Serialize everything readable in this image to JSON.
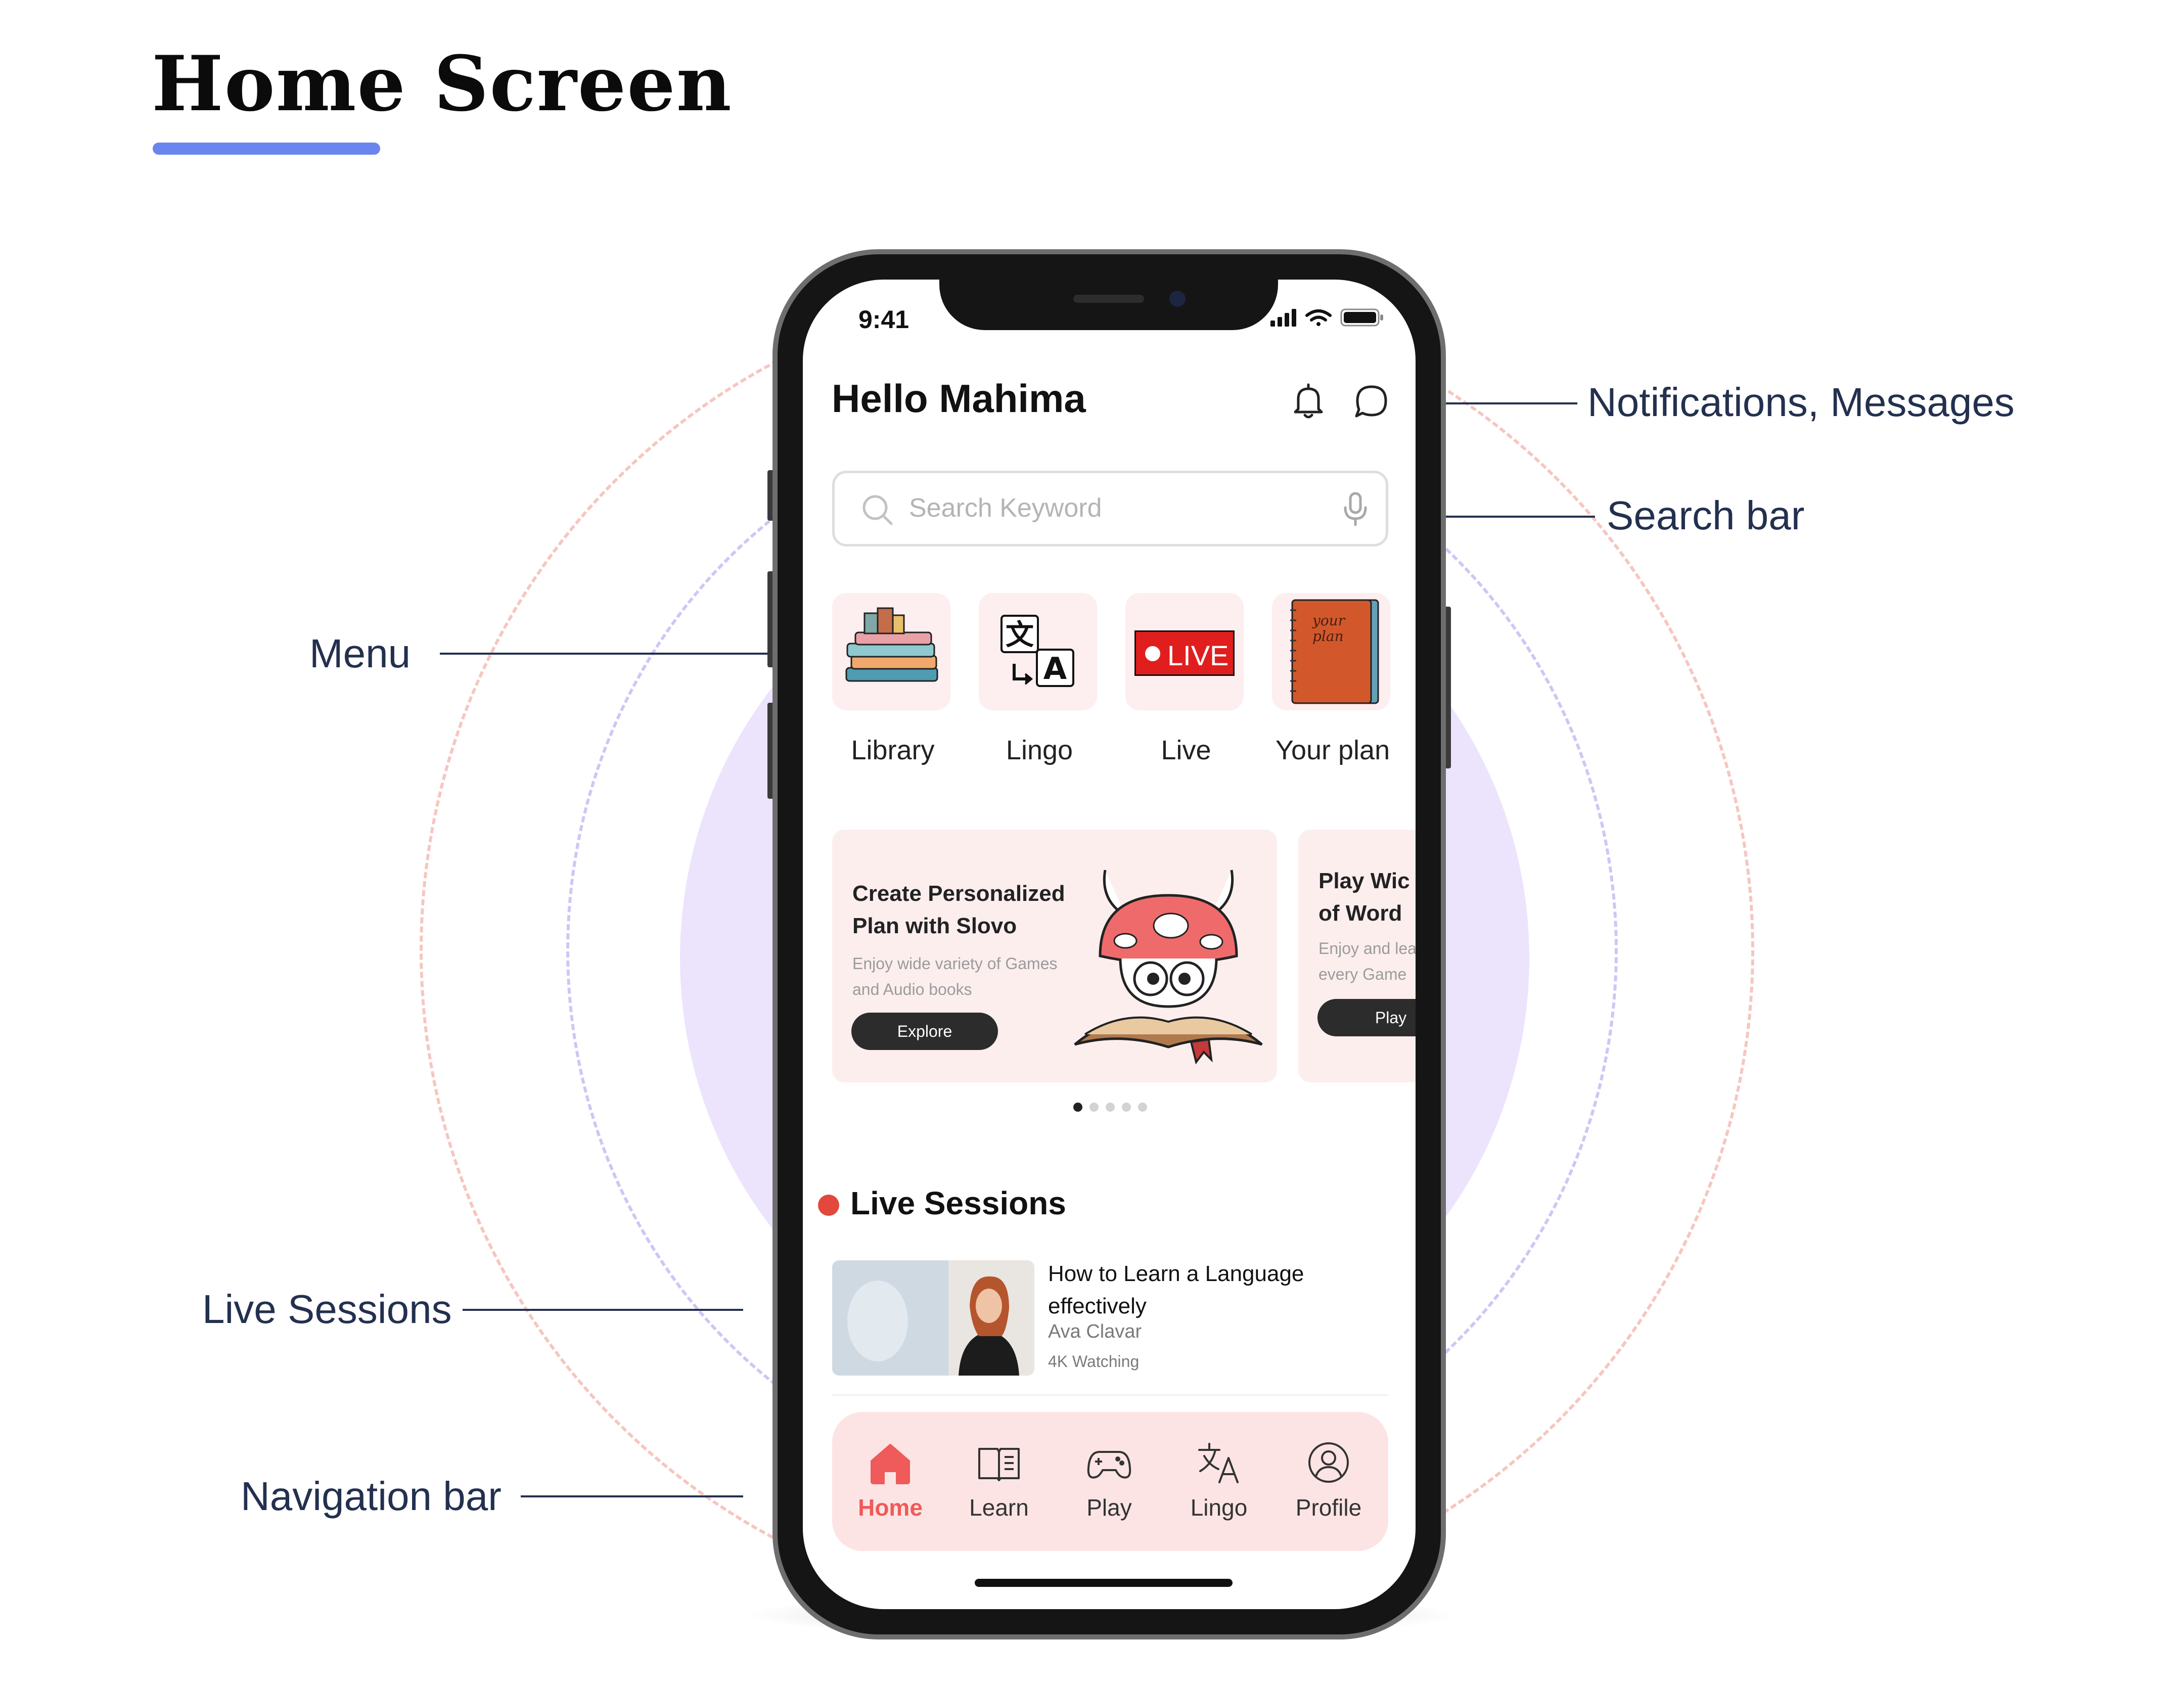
{
  "page": {
    "title": "Home Screen"
  },
  "callouts": {
    "notifications": "Notifications, Messages",
    "search": "Search bar",
    "menu": "Menu",
    "live": "Live Sessions",
    "navigation": "Navigation bar"
  },
  "status_bar": {
    "time": "9:41"
  },
  "header": {
    "greeting": "Hello Mahima",
    "icons": [
      "bell-icon",
      "message-icon"
    ]
  },
  "search": {
    "placeholder": "Search Keyword",
    "value": ""
  },
  "menu": {
    "items": [
      {
        "label": "Library",
        "icon": "books-icon"
      },
      {
        "label": "Lingo",
        "icon": "translate-icon"
      },
      {
        "label": "Live",
        "icon": "live-badge-icon",
        "badge_text": "LIVE"
      },
      {
        "label": "Your plan",
        "icon": "notebook-icon",
        "cover_text": "your plan"
      }
    ]
  },
  "carousel": {
    "cards": [
      {
        "title_line1": "Create Personalized",
        "title_line2": "Plan with Slovo",
        "subtitle_line1": "Enjoy wide variety of Games",
        "subtitle_line2": "and Audio books",
        "button": "Explore"
      },
      {
        "title_line1": "Play Wic",
        "title_line2": "of Word",
        "subtitle_line1": "Enjoy and lea",
        "subtitle_line2": "every Game",
        "button": "Play"
      }
    ],
    "page_count": 5,
    "active_index": 0
  },
  "live_sessions": {
    "title": "Live Sessions",
    "items": [
      {
        "title_line1": "How to Learn a Language",
        "title_line2": "effectively",
        "author": "Ava Clavar",
        "viewers": "4K Watching"
      }
    ]
  },
  "nav": {
    "items": [
      {
        "label": "Home",
        "icon": "home-icon",
        "active": true
      },
      {
        "label": "Learn",
        "icon": "book-open-icon",
        "active": false
      },
      {
        "label": "Play",
        "icon": "gamepad-icon",
        "active": false
      },
      {
        "label": "Lingo",
        "icon": "translate-icon",
        "active": false
      },
      {
        "label": "Profile",
        "icon": "user-icon",
        "active": false
      }
    ]
  },
  "colors": {
    "accent": "#ef5a5a",
    "underline": "#6b85ef",
    "live_red": "#e2483b",
    "tile_bg": "#fdeef0",
    "nav_bg": "#fde4e4",
    "blob": "#ece4fd"
  }
}
